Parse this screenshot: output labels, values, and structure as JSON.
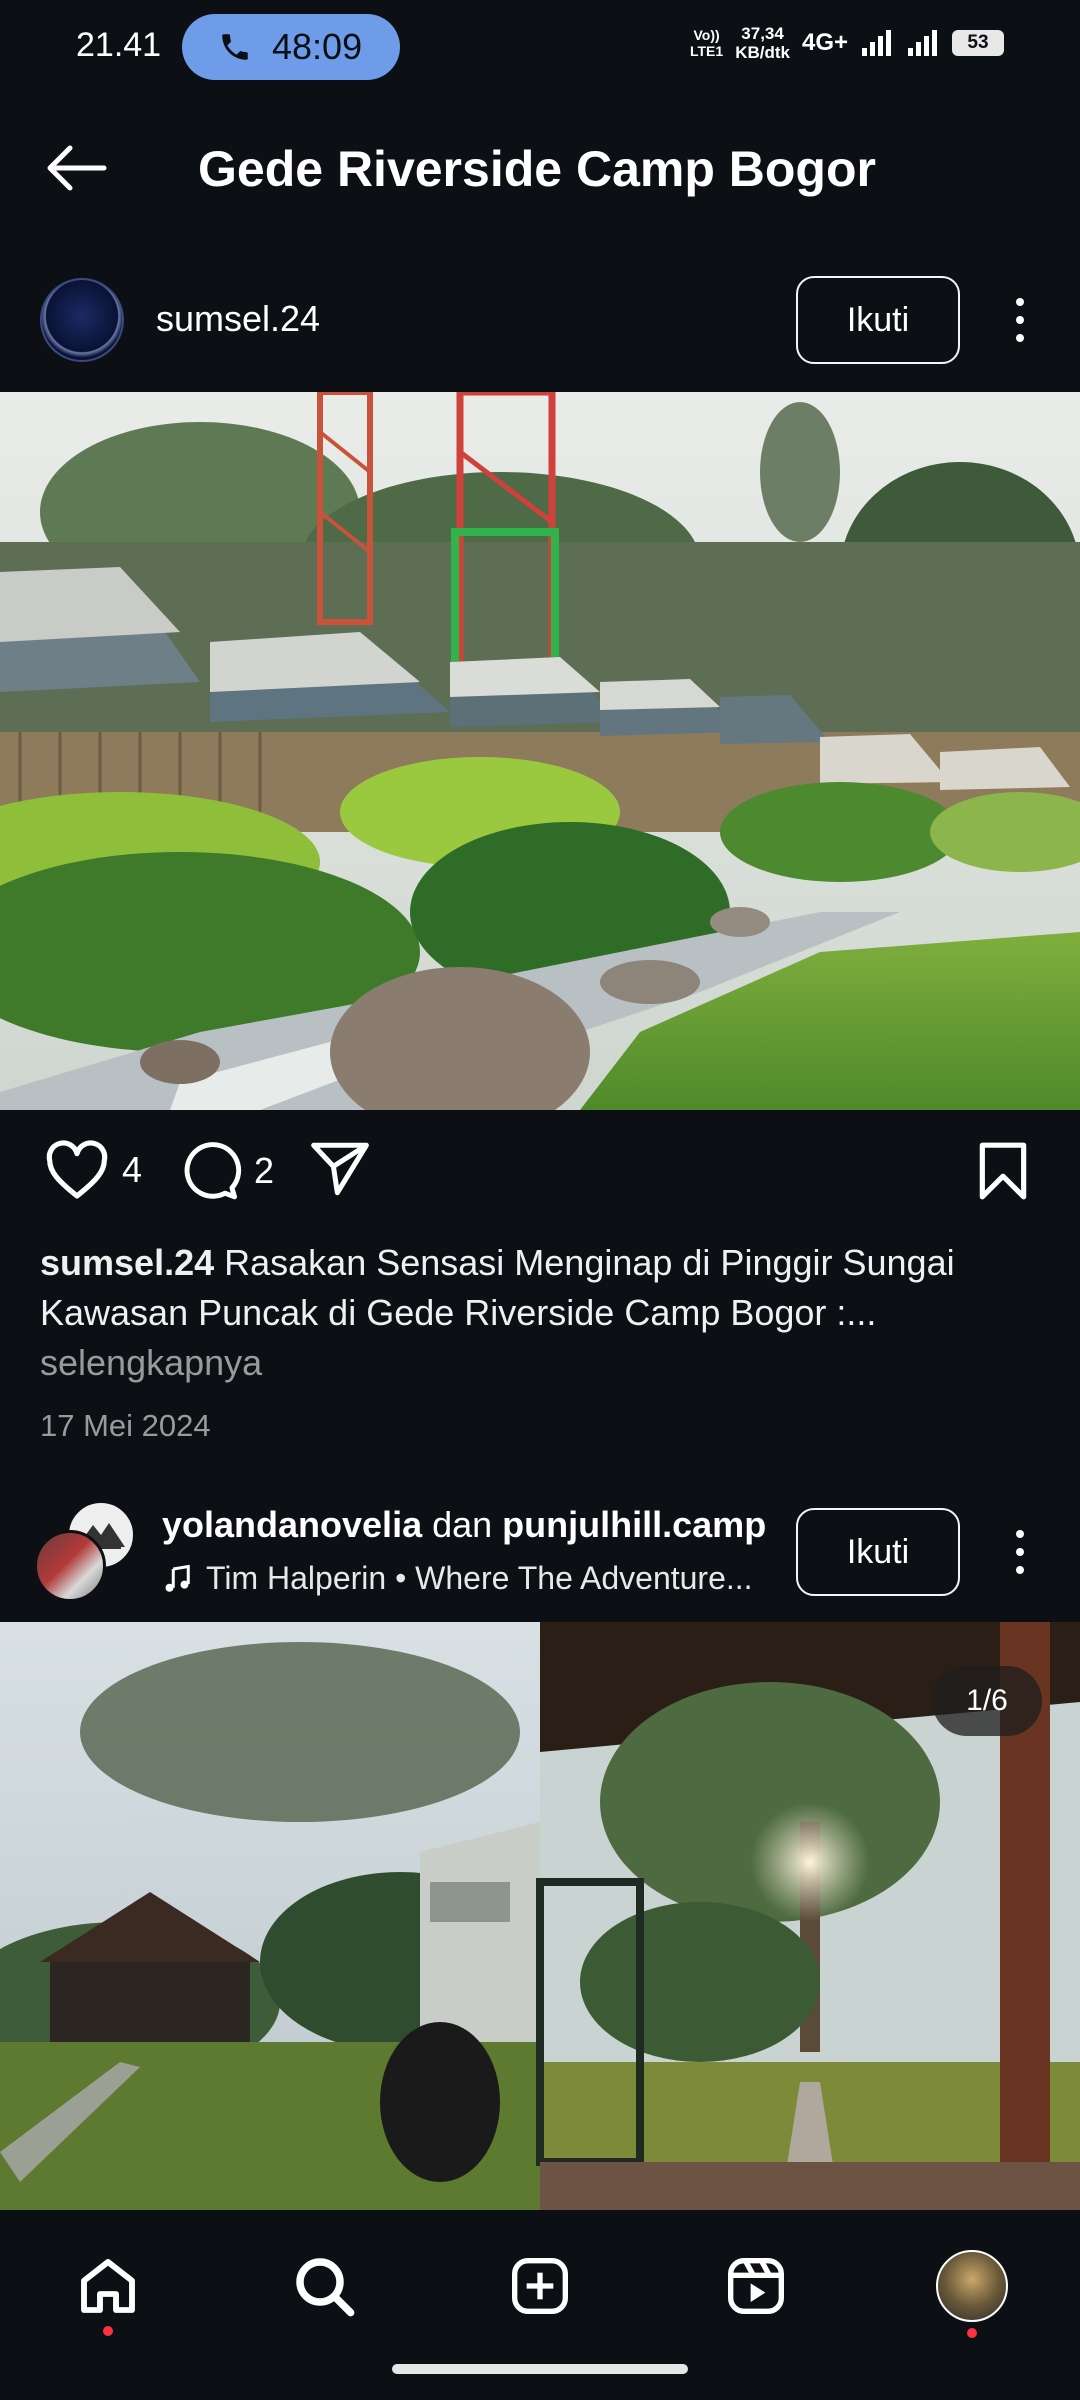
{
  "status_bar": {
    "time": "21.41",
    "call_timer": "48:09",
    "volte_line1": "Vo))",
    "volte_line2": "LTE1",
    "speed_line1": "37,34",
    "speed_line2": "KB/dtk",
    "network": "4G+",
    "battery": "53"
  },
  "header": {
    "title": "Gede Riverside Camp Bogor"
  },
  "post1": {
    "username": "sumsel.24",
    "follow_label": "Ikuti",
    "likes": "4",
    "comments": "2",
    "caption_user": "sumsel.24",
    "caption_text": " Rasakan Sensasi Menginap di Pinggir Sungai Kawasan Puncak di Gede Riverside Camp Bogor :...",
    "more_label": "selengkapnya",
    "date": "17 Mei 2024"
  },
  "post2": {
    "user1": "yolandanovelia",
    "joiner": " dan ",
    "user2": "punjulhill.camp",
    "follow_label": "Ikuti",
    "music": "Tim Halperin • Where The Adventure...",
    "carousel_counter": "1/6"
  },
  "icons": {
    "back": "arrow-left-icon",
    "phone": "phone-icon",
    "like": "heart-icon",
    "comment": "comment-icon",
    "share": "send-icon",
    "save": "bookmark-icon",
    "music": "music-note-icon",
    "home": "home-icon",
    "search": "search-icon",
    "create": "plus-square-icon",
    "reels": "reels-icon"
  },
  "colors": {
    "background": "#0c1014",
    "call_pill": "#6f9ce9",
    "notification_dot": "#ff3040"
  }
}
